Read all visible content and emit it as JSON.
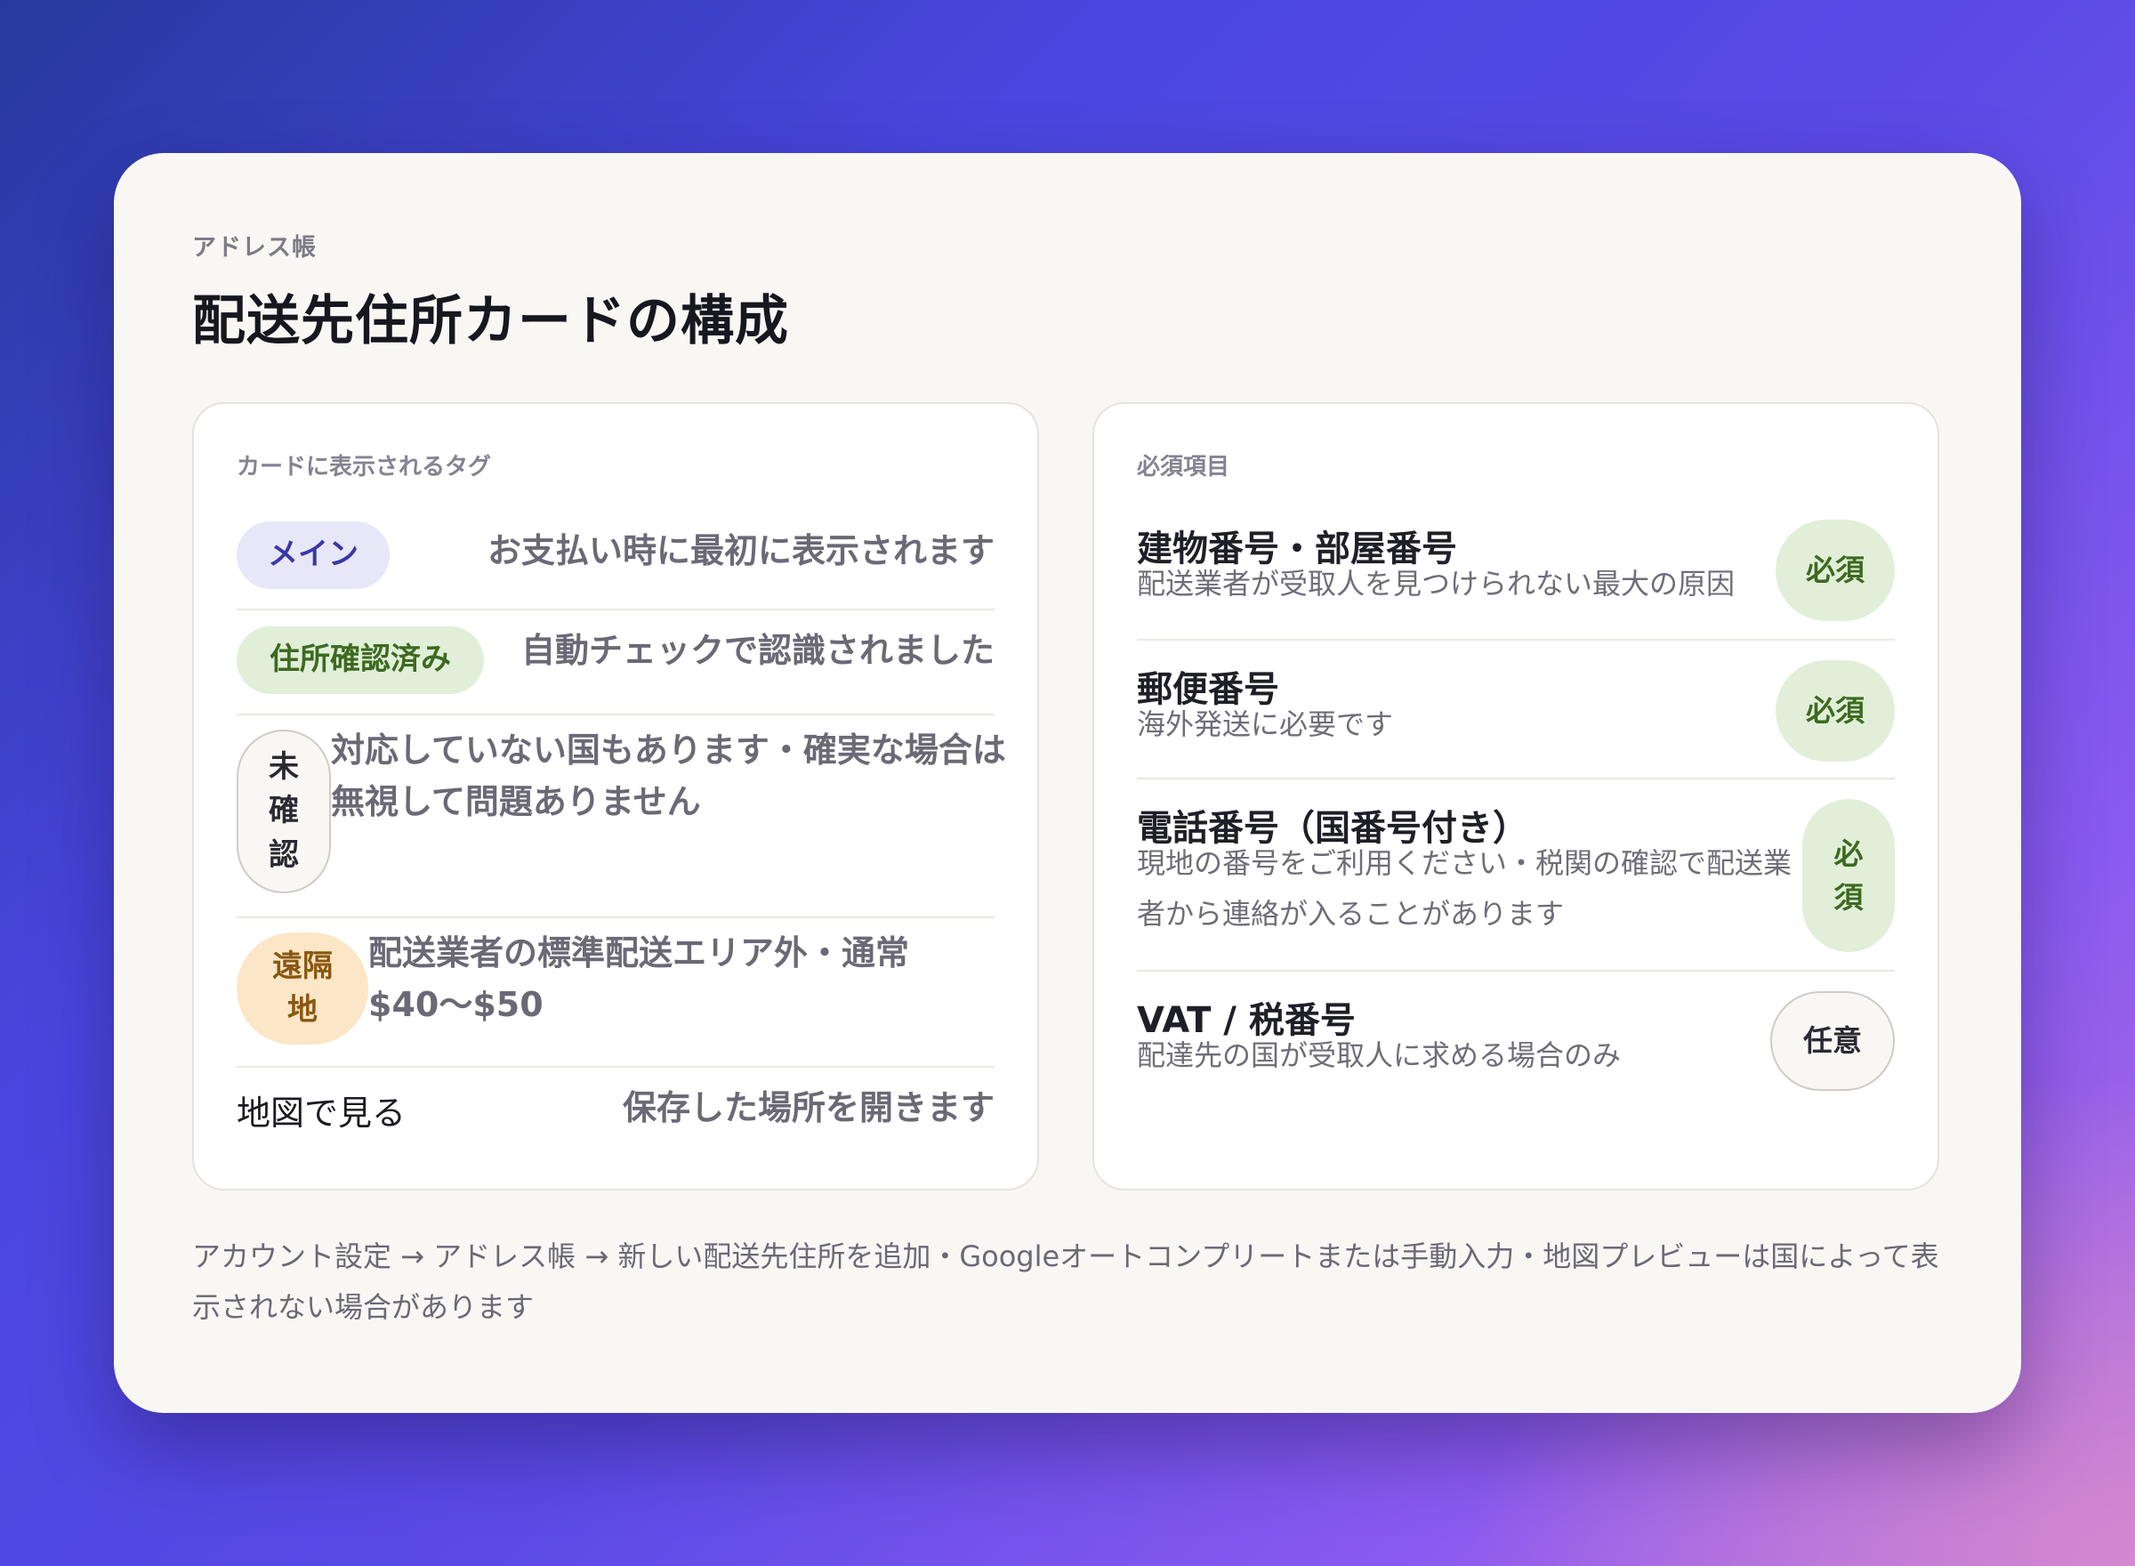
{
  "header": {
    "eyebrow": "アドレス帳",
    "title": "配送先住所カードの構成"
  },
  "tags_panel": {
    "label": "カードに表示されるタグ",
    "items": [
      {
        "tag": "メイン",
        "description": "お支払い時に最初に表示されます"
      },
      {
        "tag": "住所確認済み",
        "description": "自動チェックで認識されました"
      },
      {
        "tag": "未確認",
        "description": "対応していない国もあります・確実な場合は無視して問題ありません"
      },
      {
        "tag": "遠隔地",
        "description": "配送業者の標準配送エリア外・通常$40〜$50"
      }
    ],
    "map_link": {
      "label": "地図で見る",
      "description": "保存した場所を開きます"
    }
  },
  "required_panel": {
    "label": "必須項目",
    "items": [
      {
        "title": "建物番号・部屋番号",
        "description": "配送業者が受取人を見つけられない最大の原因",
        "badge": "必須"
      },
      {
        "title": "郵便番号",
        "description": "海外発送に必要です",
        "badge": "必須"
      },
      {
        "title": "電話番号（国番号付き）",
        "description": "現地の番号をご利用ください・税関の確認で配送業者から連絡が入ることがあります",
        "badge": "必須"
      },
      {
        "title": "VAT / 税番号",
        "description": "配達先の国が受取人に求める場合のみ",
        "badge": "任意"
      }
    ]
  },
  "footer": {
    "text": "アカウント設定 → アドレス帳 → 新しい配送先住所を追加・Googleオートコンプリートまたは手動入力・地図プレビューは国によって表示されない場合があります"
  },
  "colors": {
    "tag_main_bg": "#e8e7f8",
    "tag_verified_bg": "#e1efd9",
    "tag_remote_bg": "#fbe7c7",
    "badge_required_bg": "#e1efd9"
  }
}
